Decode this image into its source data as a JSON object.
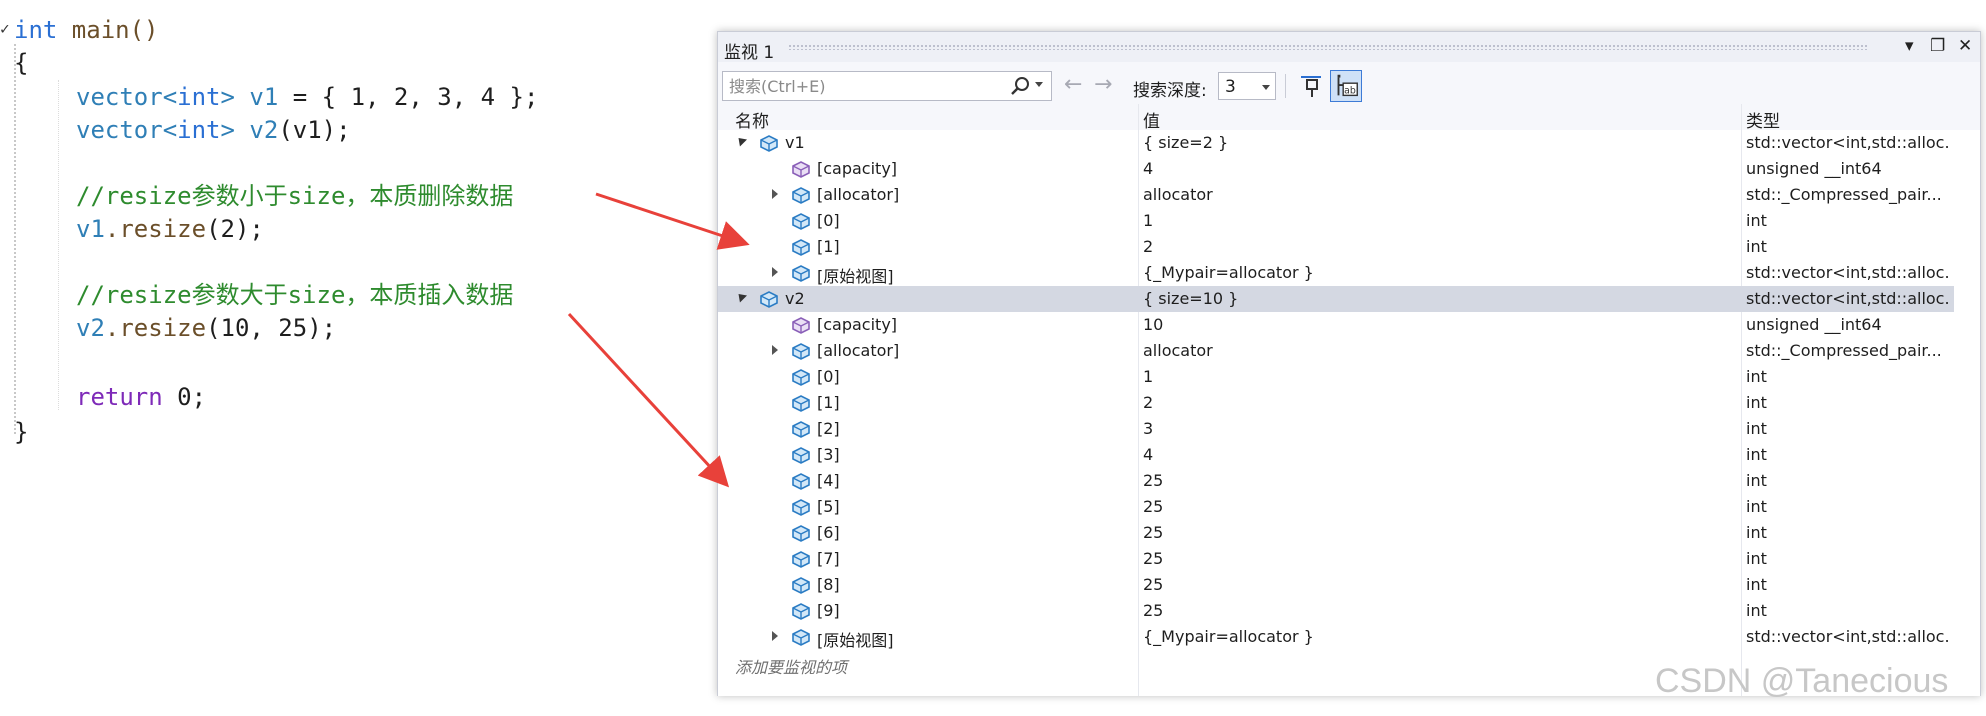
{
  "editor": {
    "lines": {
      "l1_kw": "int",
      "l1_rest": " main()",
      "l2": "{",
      "l3_kw": "int",
      "l3_a": "vector<",
      "l3_b": "> ",
      "l3_var": "v1",
      "l3_rest": " = { 1, 2, 3, 4 };",
      "l4_kw": "int",
      "l4_a": "vector<",
      "l4_b": "> ",
      "l4_var": "v2",
      "l4_rest": "(v1);",
      "l6_comment": "//resize参数小于size，本质删除数据",
      "l7_var": "v1",
      "l7_fn": ".resize",
      "l7_rest": "(2);",
      "l9_comment": "//resize参数大于size，本质插入数据",
      "l10_var": "v2",
      "l10_fn": ".resize",
      "l10_rest": "(10, 25);",
      "l12_kw": "return",
      "l12_rest": " 0;",
      "l13": "}"
    }
  },
  "watch": {
    "title": "监视 1",
    "controls": {
      "dropdown": "▾",
      "maximize": "❐",
      "close": "✕"
    },
    "search_placeholder": "搜索(Ctrl+E)",
    "back_arrow": "←",
    "forward_arrow": "→",
    "depth_label": "搜索深度:",
    "depth_value": "3",
    "columns": {
      "name": "名称",
      "value": "值",
      "type": "类型"
    },
    "rows": [
      {
        "name": "v1",
        "value": "{ size=2 }",
        "type": "std::vector<int,std::alloc...",
        "level": 0,
        "expander": "open",
        "icon": "object-icon"
      },
      {
        "name": "[capacity]",
        "value": "4",
        "type": "unsigned __int64",
        "level": 1,
        "expander": "none",
        "icon": "field-icon"
      },
      {
        "name": "[allocator]",
        "value": "allocator",
        "type": "std::_Compressed_pair...",
        "level": 1,
        "expander": "closed",
        "icon": "object-icon"
      },
      {
        "name": "[0]",
        "value": "1",
        "type": "int",
        "level": 1,
        "expander": "none",
        "icon": "object-icon"
      },
      {
        "name": "[1]",
        "value": "2",
        "type": "int",
        "level": 1,
        "expander": "none",
        "icon": "object-icon"
      },
      {
        "name": "[原始视图]",
        "value": "{_Mypair=allocator }",
        "type": "std::vector<int,std::alloc...",
        "level": 1,
        "expander": "closed",
        "icon": "object-icon"
      },
      {
        "name": "v2",
        "value": "{ size=10 }",
        "type": "std::vector<int,std::alloc...",
        "level": 0,
        "expander": "open",
        "icon": "object-icon",
        "selected": true
      },
      {
        "name": "[capacity]",
        "value": "10",
        "type": "unsigned __int64",
        "level": 1,
        "expander": "none",
        "icon": "field-icon"
      },
      {
        "name": "[allocator]",
        "value": "allocator",
        "type": "std::_Compressed_pair...",
        "level": 1,
        "expander": "closed",
        "icon": "object-icon"
      },
      {
        "name": "[0]",
        "value": "1",
        "type": "int",
        "level": 1,
        "expander": "none",
        "icon": "object-icon"
      },
      {
        "name": "[1]",
        "value": "2",
        "type": "int",
        "level": 1,
        "expander": "none",
        "icon": "object-icon"
      },
      {
        "name": "[2]",
        "value": "3",
        "type": "int",
        "level": 1,
        "expander": "none",
        "icon": "object-icon"
      },
      {
        "name": "[3]",
        "value": "4",
        "type": "int",
        "level": 1,
        "expander": "none",
        "icon": "object-icon"
      },
      {
        "name": "[4]",
        "value": "25",
        "type": "int",
        "level": 1,
        "expander": "none",
        "icon": "object-icon"
      },
      {
        "name": "[5]",
        "value": "25",
        "type": "int",
        "level": 1,
        "expander": "none",
        "icon": "object-icon"
      },
      {
        "name": "[6]",
        "value": "25",
        "type": "int",
        "level": 1,
        "expander": "none",
        "icon": "object-icon"
      },
      {
        "name": "[7]",
        "value": "25",
        "type": "int",
        "level": 1,
        "expander": "none",
        "icon": "object-icon"
      },
      {
        "name": "[8]",
        "value": "25",
        "type": "int",
        "level": 1,
        "expander": "none",
        "icon": "object-icon"
      },
      {
        "name": "[9]",
        "value": "25",
        "type": "int",
        "level": 1,
        "expander": "none",
        "icon": "object-icon"
      },
      {
        "name": "[原始视图]",
        "value": "{_Mypair=allocator }",
        "type": "std::vector<int,std::alloc...",
        "level": 1,
        "expander": "closed",
        "icon": "object-icon"
      }
    ],
    "add_item": "添加要监视的项"
  },
  "colors": {
    "arrow": "#e8413a",
    "selection": "#d4d8e2",
    "comment": "#2e8b2e",
    "keyword": "#7e2ab8"
  },
  "watermark": "CSDN @Tanecious"
}
